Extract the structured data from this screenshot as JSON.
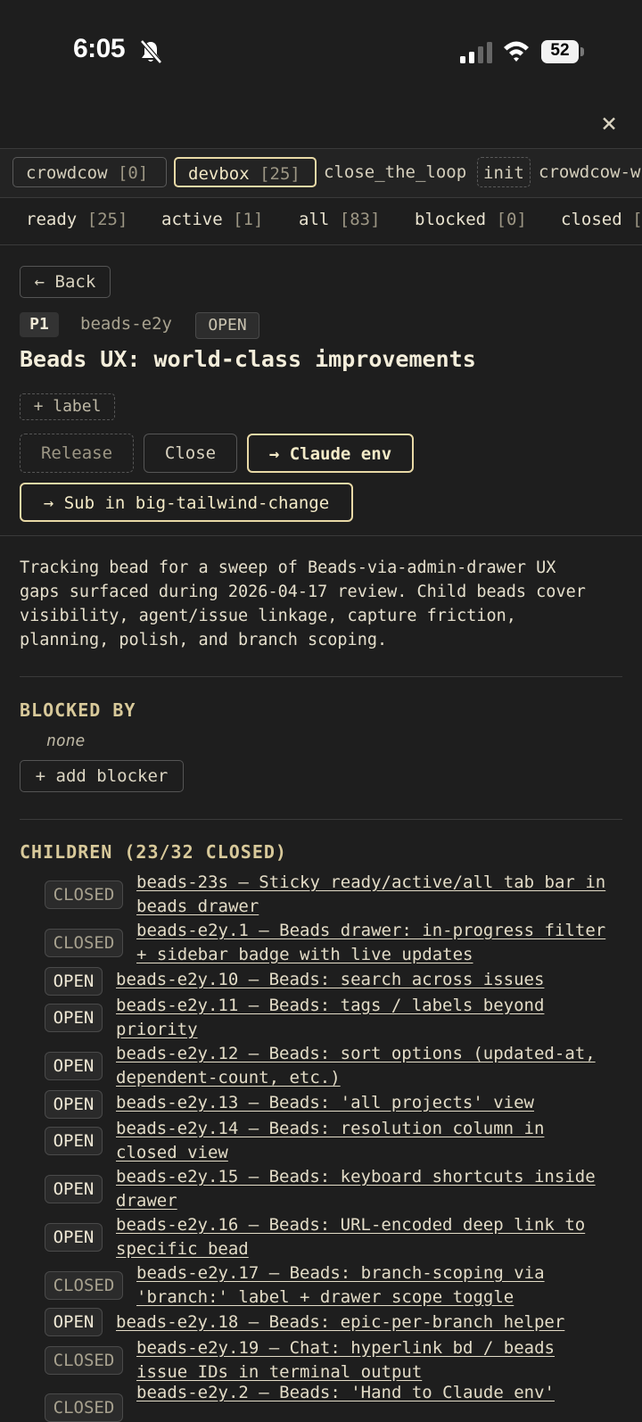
{
  "status_bar": {
    "time": "6:05",
    "battery": "52"
  },
  "close_icon": "close-icon",
  "projects": [
    {
      "name": "crowdcow",
      "count": "[0]"
    },
    {
      "name": "devbox",
      "count": "[25]"
    },
    {
      "name": "close_the_loop"
    },
    {
      "name": "init"
    },
    {
      "name": "crowdcow-w"
    }
  ],
  "filters": [
    {
      "label": "ready",
      "count": "[25]"
    },
    {
      "label": "active",
      "count": "[1]"
    },
    {
      "label": "all",
      "count": "[83]"
    },
    {
      "label": "blocked",
      "count": "[0]"
    },
    {
      "label": "closed",
      "count": "["
    }
  ],
  "back_label": "← Back",
  "bead": {
    "priority": "P1",
    "id": "beads-e2y",
    "status": "OPEN",
    "title": "Beads UX: world-class improvements",
    "label_button": "+ label",
    "actions": {
      "release": "Release",
      "close": "Close",
      "claude_env": "→ Claude env",
      "sub": "→ Sub in big-tailwind-change"
    },
    "description": "Tracking bead for a sweep of Beads-via-admin-drawer UX\ngaps surfaced during 2026-04-17 review. Child beads cover\nvisibility, agent/issue linkage, capture friction,\nplanning, polish, and branch scoping."
  },
  "blocked_by": {
    "title": "BLOCKED BY",
    "none": "none",
    "add_button": "+ add blocker"
  },
  "children": {
    "title": "CHILDREN (23/32 CLOSED)",
    "items": [
      {
        "status": "CLOSED",
        "text": "beads-23s — Sticky ready/active/all tab bar in\nbeads drawer"
      },
      {
        "status": "CLOSED",
        "text": "beads-e2y.1 — Beads drawer: in-progress filter\n+ sidebar badge with live updates"
      },
      {
        "status": "OPEN",
        "text": "beads-e2y.10 — Beads: search across issues"
      },
      {
        "status": "OPEN",
        "text": "beads-e2y.11 — Beads: tags / labels beyond\npriority"
      },
      {
        "status": "OPEN",
        "text": "beads-e2y.12 — Beads: sort options (updated-at,\ndependent-count, etc.)"
      },
      {
        "status": "OPEN",
        "text": "beads-e2y.13 — Beads: 'all projects' view"
      },
      {
        "status": "OPEN",
        "text": "beads-e2y.14 — Beads: resolution column in\nclosed view"
      },
      {
        "status": "OPEN",
        "text": "beads-e2y.15 — Beads: keyboard shortcuts inside\ndrawer"
      },
      {
        "status": "OPEN",
        "text": "beads-e2y.16 — Beads: URL-encoded deep link to\nspecific bead"
      },
      {
        "status": "CLOSED",
        "text": "beads-e2y.17 — Beads: branch-scoping via\n'branch:' label + drawer scope toggle"
      },
      {
        "status": "OPEN",
        "text": "beads-e2y.18 — Beads: epic-per-branch helper"
      },
      {
        "status": "CLOSED",
        "text": "beads-e2y.19 — Chat: hyperlink bd / beads\nissue IDs in terminal output"
      },
      {
        "status": "CLOSED",
        "text": "beads-e2y.2 — Beads: 'Hand to Claude env'"
      }
    ]
  }
}
